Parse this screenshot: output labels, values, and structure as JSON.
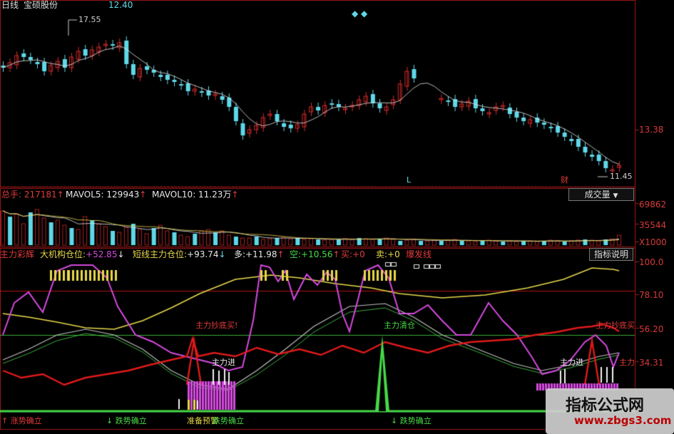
{
  "colors": {
    "up": "#d22a2a",
    "down": "#5fd8e8",
    "grid": "#a01818",
    "yellow": "#e8d84a",
    "magenta": "#d64ae0",
    "red": "#e01a1a",
    "green": "#48d848",
    "white": "#e8e8e8",
    "cyan": "#5fd8e8"
  },
  "kline": {
    "label": "日线",
    "stock": "宝硕股份",
    "price": "12.40",
    "high_label": "17.55",
    "low_label": "11.45",
    "axis_label": "13.38",
    "marker_L": "L",
    "marker_cai": "财"
  },
  "volume": {
    "total_label": "总手: 217181",
    "total_arrow": "↑",
    "mavol5_label": "MAVOL5: 129943",
    "mavol5_arrow": "↑",
    "mavol10_label": "MAVOL10: 11.23万",
    "mavol10_arrow": "↑",
    "dropdown_label": "成交量",
    "dropdown_icon": "▼",
    "axis": [
      "69862",
      "35544",
      "X1000"
    ]
  },
  "indicator": {
    "name": "主力彩辉",
    "inst_label": "大机构仓位:",
    "inst_value": "+52.85",
    "inst_arrow": "↓",
    "short_label": "短线主力仓位:",
    "short_value": "+93.74",
    "short_arrow": "↓",
    "long_label": "多:",
    "long_value": "+11.98",
    "long_arrow": "↑",
    "empty_label": "空:",
    "empty_value": "+10.56",
    "empty_arrow": "↑",
    "buy_label": "买:",
    "buy_value": "+0",
    "sell_label": "卖:",
    "sell_value": "+0",
    "burst_label": "爆发线",
    "help_button": "指标说明",
    "axis": [
      "100.0",
      "78.10",
      "56.20",
      "34.31"
    ],
    "ann_bottom_buy_1": "主力抄底买!",
    "ann_clear": "主力清仓",
    "ann_bottom_buy_2": "主力抄底买",
    "ann_enter_1": "主力进",
    "ann_enter_2": "主力进",
    "ann_main": "主力",
    "ann_up": "↑ 涨势确立",
    "ann_down_1": "↓ 跌势确立",
    "ann_prepare": "准备预警",
    "ann_down_2": "跌势确立",
    "ann_down_3": "↓ 跌势确立"
  },
  "watermark": {
    "title": "指标公式网",
    "url": "www.zbgs3.com"
  }
}
